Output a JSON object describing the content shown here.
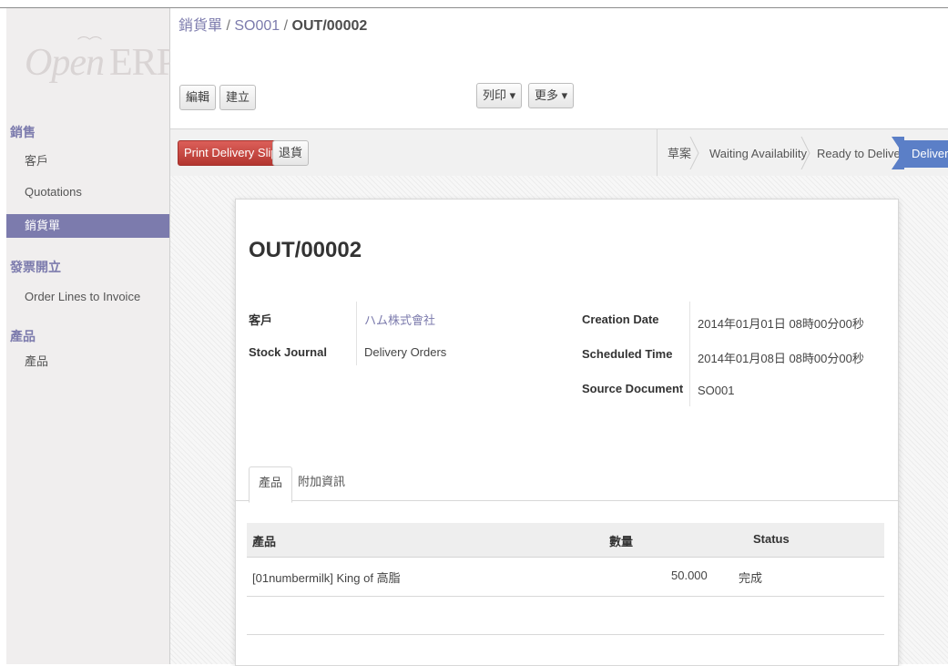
{
  "app": {
    "logo_main": "Open",
    "logo_erp": "ERP"
  },
  "breadcrumb": {
    "part1": "銷貨單",
    "sep1": "/",
    "part2": "SO001",
    "sep2": "/",
    "current": "OUT/00002"
  },
  "toolbar": {
    "edit": "編輯",
    "create": "建立",
    "print": "列印 ▾",
    "more": "更多 ▾"
  },
  "actions": {
    "print_delivery": "Print Delivery Slip",
    "return": "退貨"
  },
  "status_stages": [
    "草案",
    "Waiting Availability",
    "Ready to Deliver",
    "Delivered"
  ],
  "sidebar": {
    "sections": [
      {
        "title": "銷售",
        "items": [
          "客戶",
          "Quotations",
          "銷貨單"
        ]
      },
      {
        "title": "發票開立",
        "items": [
          "Order Lines to Invoice"
        ]
      },
      {
        "title": "產品",
        "items": [
          "產品"
        ]
      }
    ],
    "active_item": "銷貨單"
  },
  "record": {
    "title": "OUT/00002",
    "customer_label": "客戶",
    "customer_value": "ハム株式會社",
    "journal_label": "Stock Journal",
    "journal_value": "Delivery Orders",
    "creation_label": "Creation Date",
    "creation_value": "2014年01月01日 08時00分00秒",
    "scheduled_label": "Scheduled Time",
    "scheduled_value": "2014年01月08日 08時00分00秒",
    "source_label": "Source Document",
    "source_value": "SO001"
  },
  "tabs": [
    "產品",
    "附加資訊"
  ],
  "table": {
    "columns": [
      "產品",
      "數量",
      "Status"
    ],
    "rows": [
      {
        "product": "[01numbermilk] King of 高脂",
        "qty": "50.000",
        "status": "完成"
      }
    ]
  },
  "colors": {
    "accent": "#7c7bad",
    "primary_red": "#c0413b",
    "stage_active": "#5b7fc7"
  }
}
